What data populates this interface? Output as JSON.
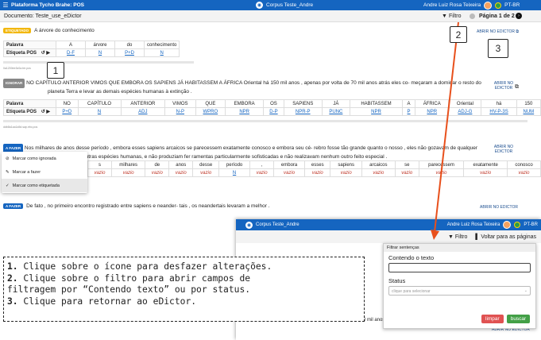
{
  "topbar": {
    "menu_icon": "hamburger-icon",
    "app_name": "Plataforma Tycho Brahe: POS",
    "corpus": "Corpus Teste_Andre",
    "user": "Andre Luiz Rosa Teixeira",
    "lang": "PT-BR"
  },
  "subbar": {
    "document": "Documento: Teste_use_eDictor",
    "filter": "Filtro",
    "page": "Página 1 de 2"
  },
  "s1": {
    "tag": "ETIQUETADO",
    "text": "A árvore do conhecimento",
    "open": "ABRIR NO EDICTOR",
    "row_word": "Palavra",
    "row_tag": "Etiqueta POS",
    "words": [
      "A",
      "árvore",
      "do",
      "conhecimento"
    ],
    "tags": [
      "D-F",
      "N",
      "P+D",
      "N"
    ],
    "meta": "0a1200ee3c0a.tre.pos"
  },
  "s2": {
    "tag": "IGNORAR",
    "text1": "NO CAPÍTULO ANTERIOR VIMOS QUE EMBORA OS SAPIENS JÁ HABITASSEM A ÁFRICA Oriental há 150 mil anos , apenas por volta de 70 mil anos atrás eles co- meçaram a dominar o resto do",
    "text2": "planeta Terra e levar as demais espécies humanas à extinção .",
    "open": "ABRIR NO EDICTOR",
    "row_word": "Palavra",
    "row_tag": "Etiqueta POS",
    "words": [
      "NO",
      "CAPÍTULO",
      "ANTERIOR",
      "VIMOS",
      "QUE",
      "EMBORA",
      "OS",
      "SAPIENS",
      "JÁ",
      "HABITASSEM",
      "A",
      "ÁFRICA",
      "Oriental",
      "há",
      "150"
    ],
    "tags": [
      "P+D",
      "N",
      "ADJ",
      "N-P",
      "WPRO",
      "NPR",
      "D-P",
      "NPR-P",
      "PUNC",
      "NPR",
      "P",
      "NPR",
      "ADJ-G",
      "HV-P-3S",
      "NUM"
    ],
    "meta": "ddb8a1aa1a5d.sap.ebc.pos"
  },
  "s3": {
    "tag": "A FAZER",
    "text1": "Nos milhares de anos desse período , embora esses sapiens arcaicos se parecessem exatamente conosco e embora seu cé- rebro fosse tão grande quanto o nosso , eles não gozavam de qualquer",
    "text2": "outras espécies humanas, e não produziam fer ramentas particularmente sofisticadas e não realizavam nenhum outro feito especial .",
    "open": "ABRIR NO EDICTOR",
    "words": [
      "s",
      "milhares",
      "de",
      "anos",
      "desse",
      "período",
      ",",
      "embora",
      "esses",
      "sapiens",
      "arcaicos",
      "se",
      "parecessem",
      "exatamente",
      "conosco"
    ],
    "tags": [
      "vazio",
      "vazio",
      "vazio",
      "vazio",
      "vazio",
      "N",
      "vazio",
      "vazio",
      "vazio",
      "vazio",
      "vazio",
      "vazio",
      "vazio",
      "vazio",
      "vazio"
    ]
  },
  "popup": {
    "ignore": "Marcar como ignorada",
    "todo": "Marcar a fazer",
    "tagged": "Marcar como etiquetada"
  },
  "s4": {
    "tag": "A FAZER",
    "text": "De fato , no primeiro encontro registrado entre sapiens e neander- tais , os neandertais levaram a melhor .",
    "open": "ABRIR NO EDICTOR"
  },
  "inset": {
    "corpus": "Corpus Teste_Andre",
    "user": "Andre Luiz Rosa Teixeira",
    "lang": "PT-BR",
    "filter": "Filtro",
    "back": "Voltar para as páginas",
    "panel_title": "Filtrar sentenças",
    "content_label": "Contendo o texto",
    "status_label": "Status",
    "status_placeholder": "clique para selecionar",
    "clear": "limpar",
    "search": "buscar",
    "frag": "0 mil anos",
    "open": "ABRIR NO EDICTOR"
  },
  "callouts": [
    "1",
    "2",
    "3"
  ],
  "note": {
    "l1n": "1.",
    "l1": " Clique sobre o ícone para desfazer alterações.",
    "l2n": "2.",
    "l2": " Clique sobre o filtro para abrir campos de",
    "l3": "filtragem por “Contendo texto” ou por status.",
    "l4n": "3.",
    "l4": " Clique para retornar ao eDictor."
  },
  "colors": {
    "primary": "#1565c0",
    "arrow": "#e8501c",
    "tag_tagged": "#f2b70c",
    "empty": "#c0392b"
  }
}
